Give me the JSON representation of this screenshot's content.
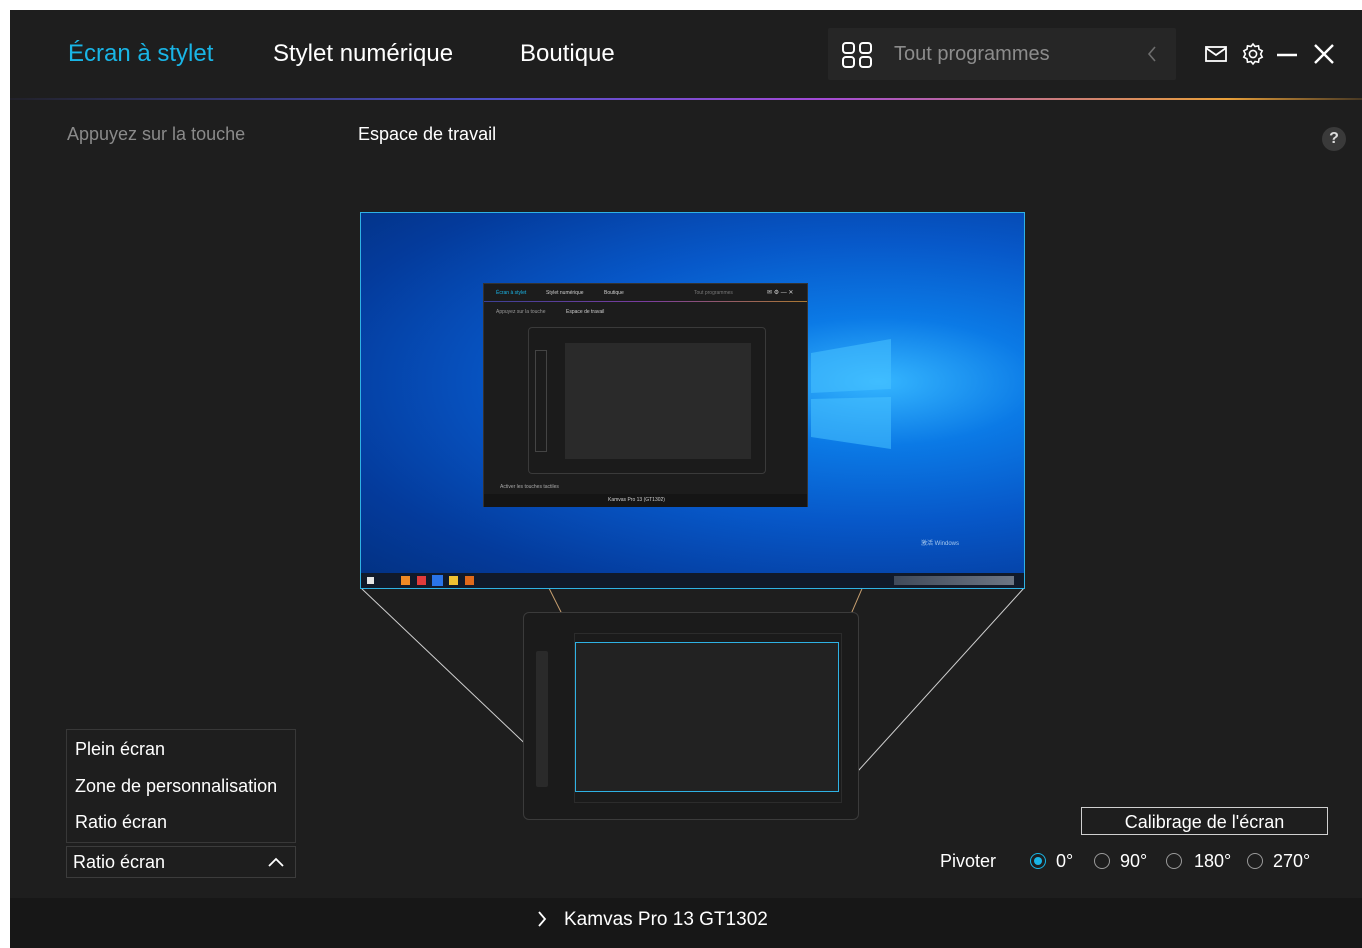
{
  "nav": {
    "tabs": [
      {
        "label": "Écran à stylet",
        "active": true
      },
      {
        "label": "Stylet numérique",
        "active": false
      },
      {
        "label": "Boutique",
        "active": false
      }
    ]
  },
  "search": {
    "icon": "apps-grid-icon",
    "placeholder": "Tout programmes"
  },
  "window_controls": {
    "icons": [
      "mail-icon",
      "gear-icon",
      "minimize-icon",
      "close-icon"
    ]
  },
  "subtabs": [
    {
      "label": "Appuyez sur la touche",
      "active": false
    },
    {
      "label": "Espace de travail",
      "active": true
    }
  ],
  "help": {
    "label": "?"
  },
  "preview": {
    "mini_app": {
      "tabs": [
        "Écran à stylet",
        "Stylet numérique",
        "Boutique"
      ],
      "search": "Tout programmes",
      "subtabs": [
        "Appuyez sur la touche",
        "Espace de travail"
      ],
      "checkbox_label": "Activer les touches tactiles",
      "device": "Kamvas Pro 13 (GT1302)"
    },
    "windows_watermark": "激活 Windows"
  },
  "mapping": {
    "options": [
      "Plein écran",
      "Zone de personnalisation",
      "Ratio écran"
    ],
    "selected": "Ratio écran"
  },
  "calibrate_button": "Calibrage de l'écran",
  "rotate": {
    "label": "Pivoter",
    "options": [
      "0°",
      "90°",
      "180°",
      "270°"
    ],
    "selected": "0°"
  },
  "footer": {
    "device": "Kamvas Pro 13 GT1302"
  },
  "colors": {
    "accent": "#19b5e6",
    "background": "#1e1e1e",
    "footer": "#171717"
  }
}
